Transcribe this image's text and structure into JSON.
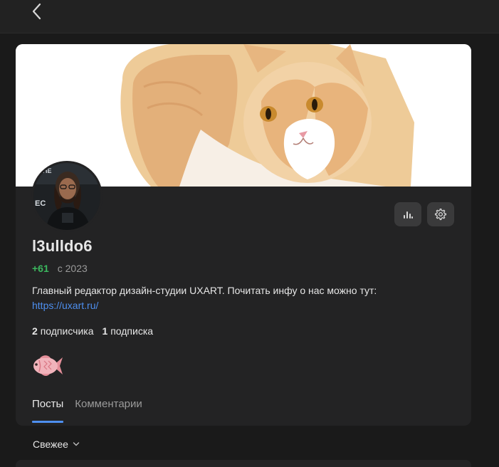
{
  "nav": {
    "back_icon": "chevron-left-icon"
  },
  "profile": {
    "cover_icon": "cat-loaf-image",
    "avatar_icon": "avatar-photo",
    "username": "l3ulldo6",
    "karma": "+61",
    "since": "с 2023",
    "bio_text": "Главный редактор дизайн-студии UXART. Почитать инфу о нас можно тут:",
    "bio_link": "https://uxart.ru/",
    "followers_count": "2",
    "followers_label": "подписчика",
    "following_count": "1",
    "following_label": "подписка",
    "badge_icon": "fish-icon",
    "stats_icon": "bar-chart-icon",
    "settings_icon": "gear-icon"
  },
  "tabs": [
    {
      "label": "Посты",
      "active": true
    },
    {
      "label": "Комментарии",
      "active": false
    }
  ],
  "sort": {
    "label": "Свежее",
    "icon": "chevron-down-icon"
  },
  "colors": {
    "background": "#1a1a1a",
    "card": "#232324",
    "accent": "#4e8fef",
    "karma": "#3bb75e"
  }
}
